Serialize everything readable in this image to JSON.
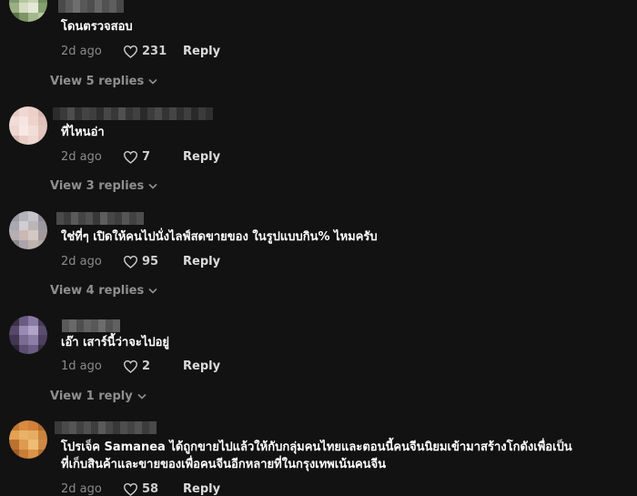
{
  "comments": [
    {
      "text": "โดนตรวจสอบ",
      "date": "2d ago",
      "likes": "231",
      "reply_label": "Reply",
      "view_replies": "View 5 replies",
      "avatar_colors": [
        "#6b8a5e",
        "#8fa870",
        "#a7b88a",
        "#5d7a4e",
        "#7e9a67",
        "#b6c69a",
        "#c9d4ae",
        "#6f8c5a",
        "#9bb07e",
        "#d4dcbf",
        "#e4e8d4",
        "#83a06a",
        "#587448",
        "#7a9562",
        "#a3b98a",
        "#b8c8a0"
      ]
    },
    {
      "text": "ที่ไหนอ่า",
      "date": "2d ago",
      "likes": "7",
      "reply_label": "Reply",
      "view_replies": "View 3 replies",
      "avatar_colors": [
        "#e8c9c4",
        "#f2d6d0",
        "#eecfc8",
        "#d9b4ac",
        "#f4dcd6",
        "#f7e4df",
        "#efd2cb",
        "#e2c0b8",
        "#f0d7d0",
        "#f9e8e3",
        "#f5ddd6",
        "#e6c5bd",
        "#dbb8b0",
        "#eccdc5",
        "#f1d8d1",
        "#e4c3bb"
      ]
    },
    {
      "text": "ใช่ที่ๆ เปิดให้คนไปนั่งไลฟ์สดขายของ ในรูปแบบกิน% ไหมครับ",
      "date": "2d ago",
      "likes": "95",
      "reply_label": "Reply",
      "view_replies": "View 4 replies",
      "avatar_colors": [
        "#9a9aa4",
        "#b3b3bd",
        "#c6c4cc",
        "#8d8b95",
        "#a9a7b1",
        "#d0ced4",
        "#bdb5b8",
        "#9d98a0",
        "#b7aeb2",
        "#c9b9b4",
        "#d6c8c2",
        "#a49a9c",
        "#8f8a92",
        "#aca5aa",
        "#c0b2ae",
        "#b5a8a6"
      ]
    },
    {
      "text": "เอ๊า เสาร์นี้ว่าจะไปอยู่",
      "date": "1d ago",
      "likes": "2",
      "reply_label": "Reply",
      "view_replies": "View 1 reply",
      "avatar_colors": [
        "#3d2f4a",
        "#6a5a86",
        "#8c7aa8",
        "#4a3a5c",
        "#57476b",
        "#9a88b8",
        "#b3a2cc",
        "#5c4c72",
        "#433554",
        "#7b6a98",
        "#8e7dab",
        "#4f3f63",
        "#2f2438",
        "#5e4e74",
        "#6d5c88",
        "#3a2d46"
      ]
    },
    {
      "text": "โปรเจ็ค Samanea ได้ถูกขายไปแล้วให้กับกลุ่มคนไทยและตอนนี้คนจีนนิยมเข้ามาสร้างโกดังเพื่อเป็น",
      "text_line2": "ที่เก็บสินค้าและขายของเพื่อคนจีนอีกหลายที่ในกรุงเทพเน้นคนจีน",
      "date": "2d ago",
      "likes": "58",
      "reply_label": "Reply",
      "avatar_colors": [
        "#c9772a",
        "#e08a35",
        "#d98030",
        "#b86a24",
        "#e8a04a",
        "#f0b060",
        "#ecac58",
        "#d08435",
        "#c27028",
        "#e49a45",
        "#f2bc6e",
        "#d68a3a",
        "#a85e1f",
        "#cf7c2e",
        "#e29240",
        "#bd6c26"
      ]
    }
  ],
  "username_colors": {
    "c1": [
      "#4a4a4a",
      "#5c5c5c",
      "#6e6e6e",
      "#585858",
      "#4e4e4e",
      "#666666",
      "#525252",
      "#5e5e5e",
      "#484848"
    ],
    "c2": [
      "#2c2c2c",
      "#3a3a3a",
      "#4d4d4d",
      "#333333",
      "#444444",
      "#3e3e3e",
      "#2e2e2e",
      "#474747",
      "#383838",
      "#505050",
      "#363636",
      "#414141",
      "#2a2a2a",
      "#3c3c3c",
      "#4a4a4a",
      "#343434",
      "#454545",
      "#303030",
      "#3f3f3f",
      "#292929",
      "#3b3b3b",
      "#2f2f2f"
    ],
    "c3": [
      "#4a4a4a",
      "#3c3c3c",
      "#5a5a5a",
      "#444444",
      "#505050",
      "#383838",
      "#5e5e5e",
      "#474747",
      "#3e3e3e",
      "#555555",
      "#424242",
      "#4d4d4d"
    ],
    "c4": [
      "#5a5a5a",
      "#686868",
      "#4e4e4e",
      "#626262",
      "#585858",
      "#6c6c6c",
      "#525252",
      "#606060"
    ],
    "c5": [
      "#3a3a3a",
      "#4a4a4a",
      "#555555",
      "#424242",
      "#505050",
      "#3e3e3e",
      "#5a5a5a",
      "#474747",
      "#383838",
      "#4e4e4e",
      "#444444",
      "#525252",
      "#3c3c3c",
      "#494949"
    ]
  }
}
